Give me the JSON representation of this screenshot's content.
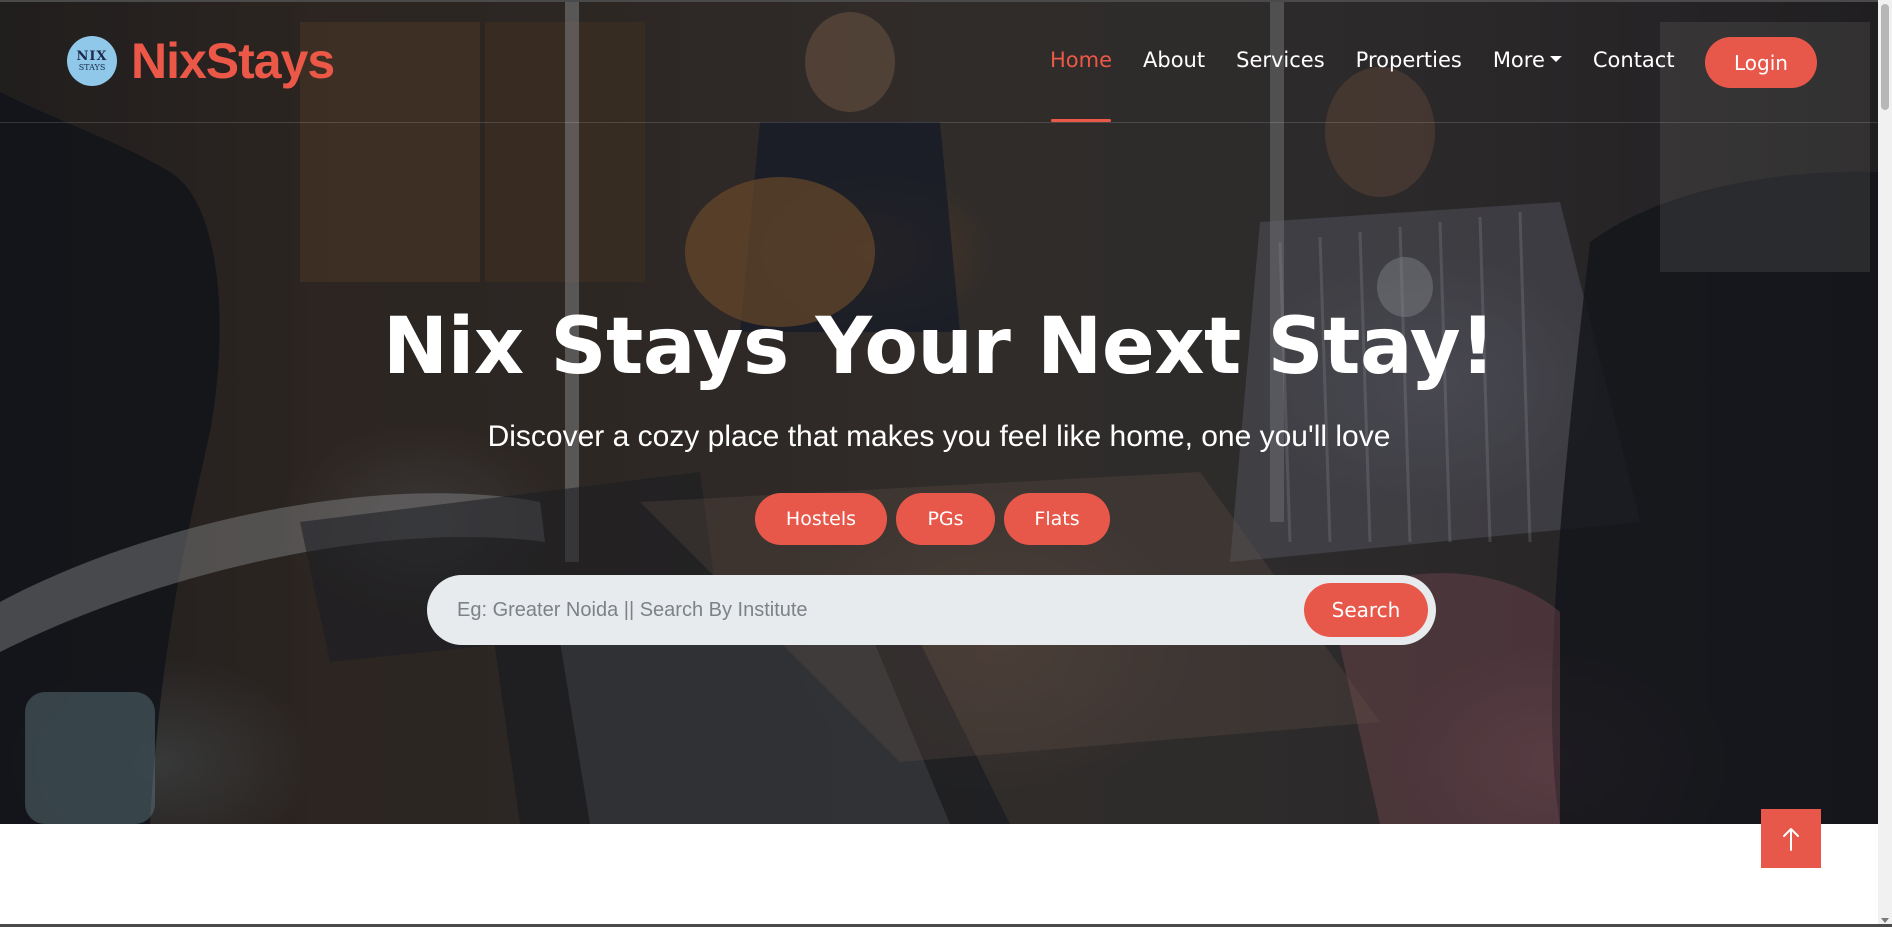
{
  "brand": {
    "logo_text_top": "NIX",
    "logo_text_bottom": "STAYS",
    "name": "NixStays"
  },
  "nav": {
    "items": [
      {
        "label": "Home",
        "active": true
      },
      {
        "label": "About"
      },
      {
        "label": "Services"
      },
      {
        "label": "Properties"
      },
      {
        "label": "More",
        "dropdown": true
      },
      {
        "label": "Contact"
      }
    ],
    "login_label": "Login"
  },
  "hero": {
    "title": "Nix Stays Your Next Stay!",
    "subtitle": "Discover a cozy place that makes you feel like home, one you'll love",
    "categories": [
      "Hostels",
      "PGs",
      "Flats"
    ],
    "search": {
      "placeholder": "Eg: Greater Noida || Search By Institute",
      "button_label": "Search"
    }
  },
  "icons": {
    "back_to_top": "arrow-up-icon",
    "dropdown": "caret-down-icon"
  },
  "colors": {
    "accent": "#E8584A",
    "brand_text": "#EC5848",
    "search_bg": "#E8EBEE",
    "nav_text": "#FFFFFF"
  }
}
